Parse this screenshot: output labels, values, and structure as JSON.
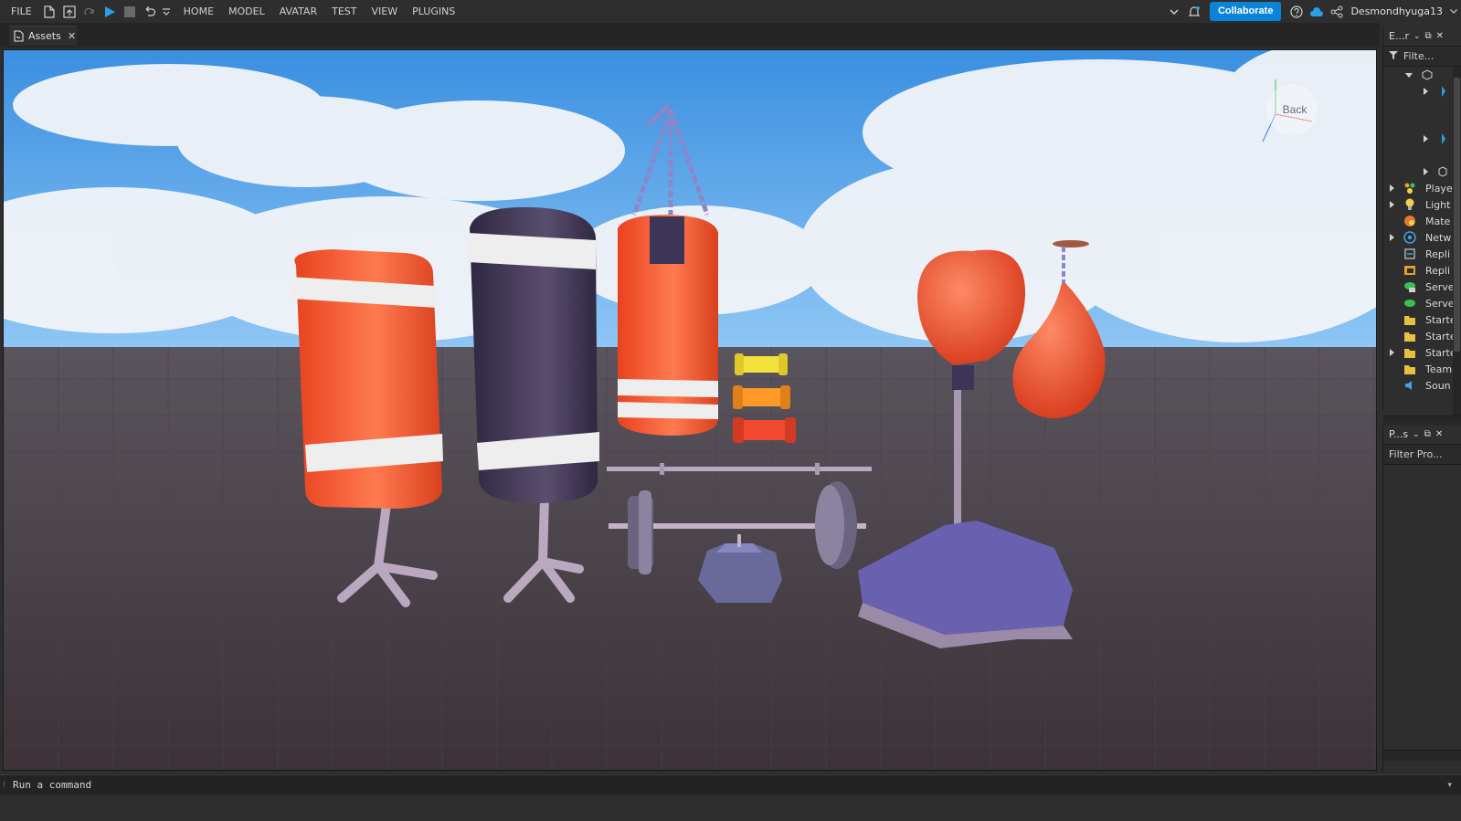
{
  "menubar": {
    "file": "FILE",
    "tabs": [
      "HOME",
      "MODEL",
      "AVATAR",
      "TEST",
      "VIEW",
      "PLUGINS"
    ],
    "collaborate": "Collaborate",
    "username": "Desmondhyuga13"
  },
  "tabbar": {
    "tab_label": "Assets"
  },
  "viewport": {
    "view_cube_label": "Back"
  },
  "explorer": {
    "title": "E...r",
    "filter_placeholder": "Filte...",
    "items": [
      {
        "label": "Playe",
        "color": "#e0a030"
      },
      {
        "label": "Light",
        "color": "#f2d24a"
      },
      {
        "label": "Mate",
        "color": "#e07a30"
      },
      {
        "label": "Netw",
        "color": "#4aa0e0"
      },
      {
        "label": "Repli",
        "color": "#c0c0c0"
      },
      {
        "label": "Repli",
        "color": "#e0a030"
      },
      {
        "label": "Serve",
        "color": "#3cbf5a"
      },
      {
        "label": "Serve",
        "color": "#3cbf5a"
      },
      {
        "label": "Starte",
        "color": "#e8c040"
      },
      {
        "label": "Starte",
        "color": "#e8c040"
      },
      {
        "label": "Starte",
        "color": "#e8c040"
      },
      {
        "label": "Team",
        "color": "#e8c040"
      },
      {
        "label": "Soun",
        "color": "#4aa0e0"
      }
    ]
  },
  "properties": {
    "title": "P...s",
    "filter_placeholder": "Filter Pro..."
  },
  "command": {
    "placeholder": "Run a command"
  },
  "colors": {
    "accent": "#0a84d6",
    "panel": "#2e2e2e",
    "bag_red": "#f2522e",
    "bag_navy": "#3d3556"
  }
}
